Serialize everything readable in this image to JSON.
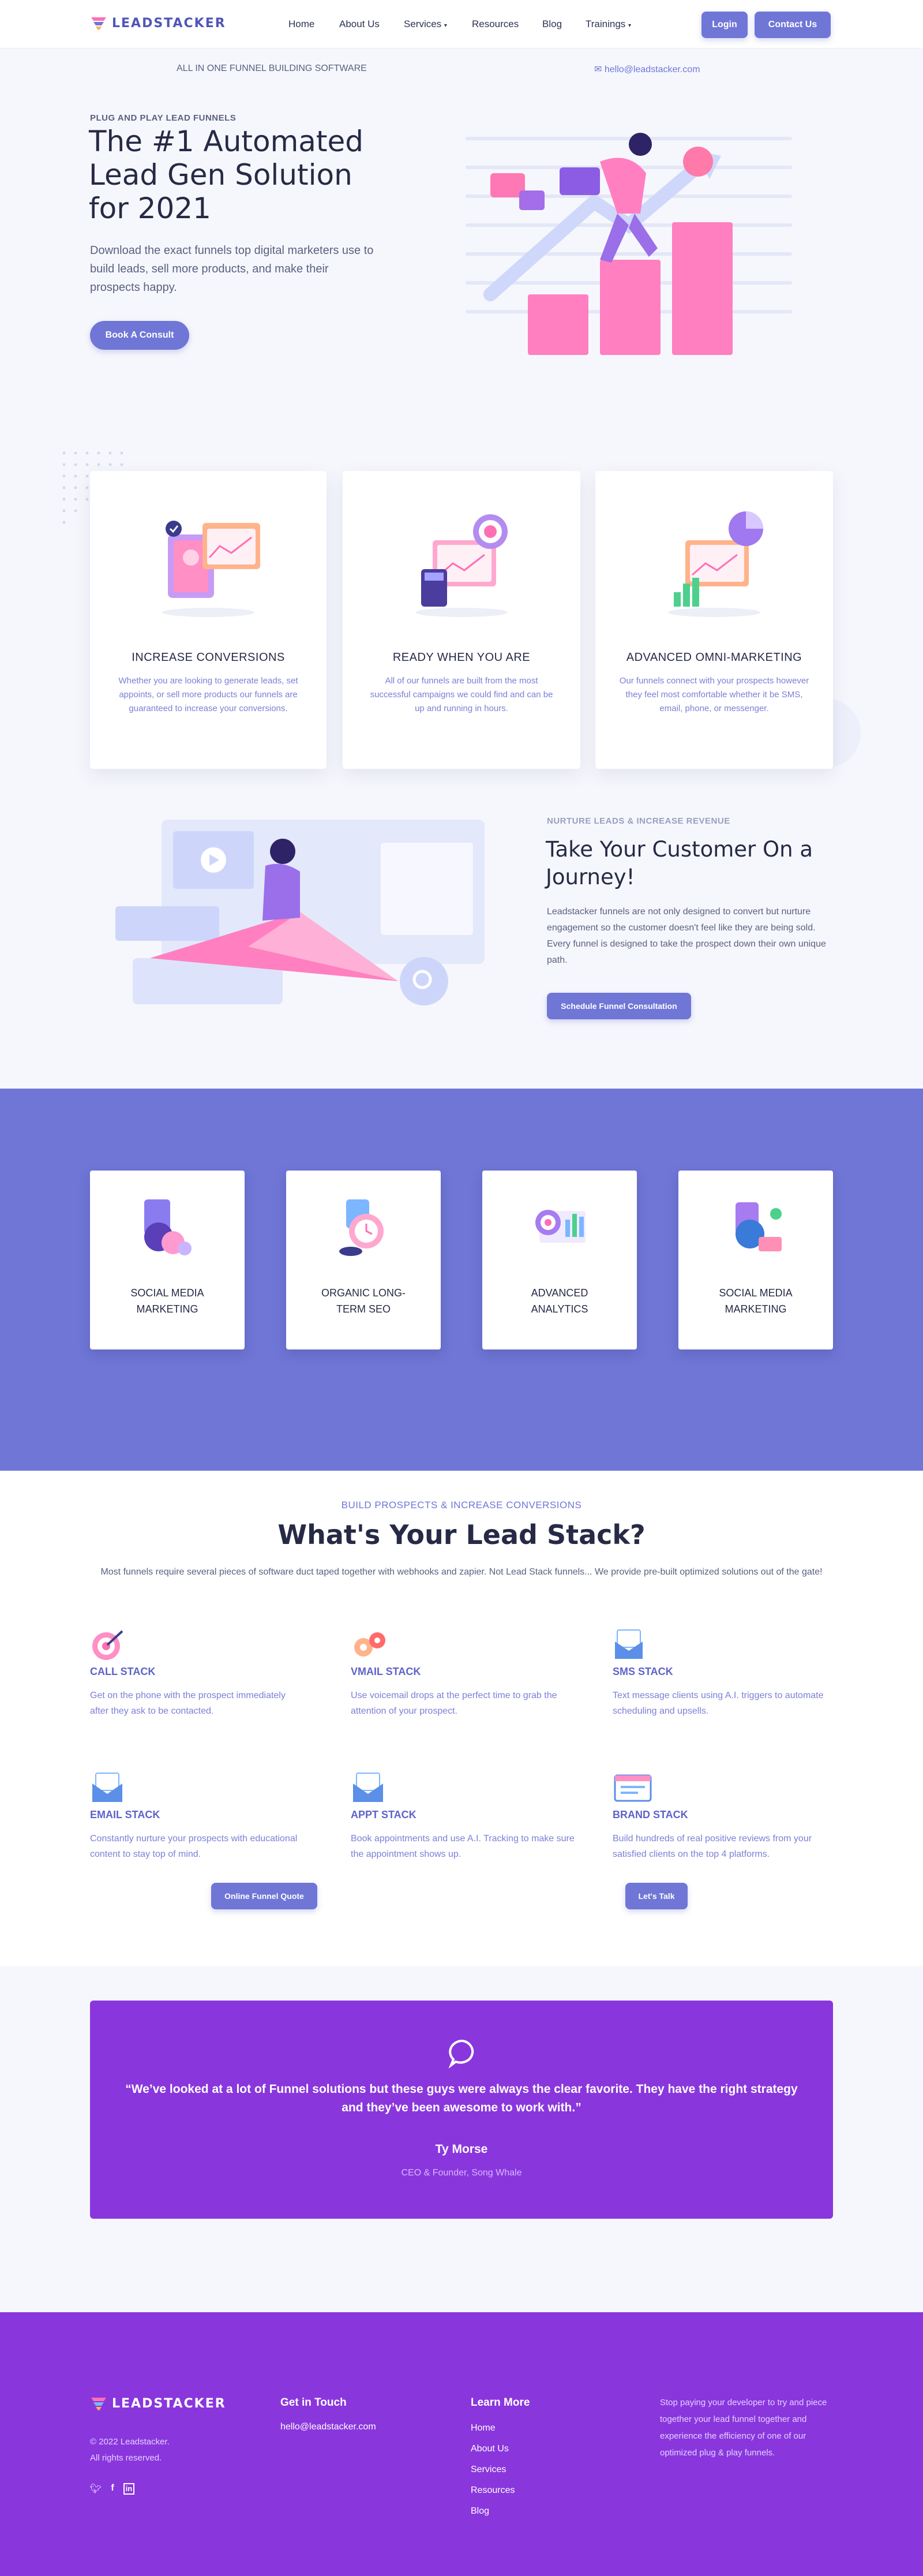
{
  "brand": {
    "name": "LEADSTACKER",
    "accent": "#7076d6",
    "purple": "#8a36dd",
    "pink": "#ff6fb3"
  },
  "nav": {
    "home": "Home",
    "about": "About Us",
    "services": "Services",
    "resources": "Resources",
    "blog": "Blog",
    "trainings": "Trainings",
    "login": "Login",
    "contact": "Contact Us"
  },
  "topbar": {
    "tagline": "ALL IN ONE FUNNEL BUILDING SOFTWARE",
    "email": "hello@leadstacker.com"
  },
  "hero": {
    "eyebrow": "PLUG AND PLAY LEAD FUNNELS",
    "title_l1": "The #1 Automated",
    "title_l2": "Lead Gen Solution",
    "title_l3": "for 2021",
    "text": "Download the exact funnels top digital marketers use to build leads, sell more products, and make their prospects happy.",
    "cta": "Book A Consult"
  },
  "features": [
    {
      "title": "INCREASE CONVERSIONS",
      "text": "Whether you are looking to generate leads, set appoints, or sell more products our funnels are guaranteed to increase your conversions."
    },
    {
      "title": "READY WHEN YOU ARE",
      "text": "All of our funnels are built from the most successful campaigns we could find and can be up and running in hours."
    },
    {
      "title": "ADVANCED OMNI-MARKETING",
      "text": "Our funnels connect with your prospects however they feel most comfortable whether it be SMS, email, phone, or messenger."
    }
  ],
  "journey": {
    "eyebrow": "NURTURE LEADS & INCREASE REVENUE",
    "title_l1": "Take Your Customer On a",
    "title_l2": "Journey!",
    "text": "Leadstacker funnels are not only designed to convert but nurture engagement so the customer doesn't feel like they are being sold. Every funnel is designed to take the prospect down their own unique path.",
    "cta": "Schedule Funnel Consultation"
  },
  "services": [
    {
      "l1": "SOCIAL MEDIA",
      "l2": "MARKETING"
    },
    {
      "l1": "ORGANIC LONG-",
      "l2": "TERM SEO"
    },
    {
      "l1": "ADVANCED",
      "l2": "ANALYTICS"
    },
    {
      "l1": "SOCIAL MEDIA",
      "l2": "MARKETING"
    }
  ],
  "stack": {
    "eyebrow": "BUILD PROSPECTS & INCREASE CONVERSIONS",
    "title": "What's Your Lead Stack?",
    "text": "Most funnels require several pieces of software duct taped together with webhooks and zapier. Not Lead Stack funnels... We provide pre-built optimized solutions out of the gate!",
    "items": [
      {
        "title": "CALL STACK",
        "text": "Get on the phone with the prospect immediately after they ask to be contacted."
      },
      {
        "title": "VMAIL STACK",
        "text": "Use voicemail drops at the perfect time to grab the attention of your prospect."
      },
      {
        "title": "SMS STACK",
        "text": "Text message clients using A.I. triggers to automate scheduling and upsells."
      },
      {
        "title": "EMAIL STACK",
        "text": "Constantly nurture your prospects with educational content to stay top of mind."
      },
      {
        "title": "APPT STACK",
        "text": "Book appointments and use A.I. Tracking to make sure the appointment shows up."
      },
      {
        "title": "BRAND STACK",
        "text": "Build hundreds of real positive reviews from your satisfied clients on the top 4 platforms."
      }
    ],
    "cta1": "Online Funnel Quote",
    "cta2": "Let's Talk"
  },
  "testimonial": {
    "quote": "“We’ve looked at a lot of Funnel solutions but these guys were always the clear favorite. They have the right strategy and they’ve been awesome to work with.”",
    "name": "Ty Morse",
    "role": "CEO & Founder, Song Whale"
  },
  "footer": {
    "copyright": "© 2022 Leadstacker.",
    "rights": "All rights reserved.",
    "get_in_touch": "Get in Touch",
    "email": "hello@leadstacker.com",
    "learn_more": "Learn More",
    "links": [
      "Home",
      "About Us",
      "Services",
      "Resources",
      "Blog"
    ],
    "blurb": "Stop paying your developer to try and piece together your lead funnel together and experience the efficiency of one of our optimized plug & play funnels."
  }
}
